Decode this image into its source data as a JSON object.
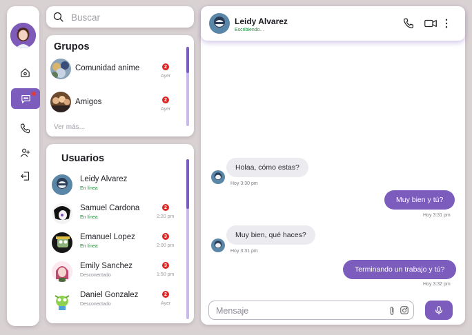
{
  "search": {
    "placeholder": "Buscar"
  },
  "groups": {
    "title": "Grupos",
    "items": [
      {
        "name": "Comunidad anime",
        "badge": "2",
        "time": "Ayer"
      },
      {
        "name": "Amigos",
        "badge": "2",
        "time": "Ayer"
      }
    ],
    "see_more": "Ver más..."
  },
  "users": {
    "title": "Usuarios",
    "items": [
      {
        "name": "Leidy Alvarez",
        "status": "En línea",
        "badge": "",
        "time": ""
      },
      {
        "name": "Samuel Cardona",
        "status": "En línea",
        "badge": "2",
        "time": "2:20 pm"
      },
      {
        "name": "Emanuel Lopez",
        "status": "En línea",
        "badge": "3",
        "time": "2:00 pm"
      },
      {
        "name": "Emily Sanchez",
        "status": "Desconectado",
        "badge": "3",
        "time": "1:50 pm"
      },
      {
        "name": "Daniel Gonzalez",
        "status": "Desconectado",
        "badge": "2",
        "time": "Ayer"
      }
    ]
  },
  "chat": {
    "contact_name": "Leidy Alvarez",
    "contact_status": "Escribiendo...",
    "messages": [
      {
        "direction": "in",
        "text": "Holaa, cómo estas?",
        "time": "Hoy 3:30 pm"
      },
      {
        "direction": "out",
        "text": "Muy bien y tú?",
        "time": "Hoy 3:31 pm"
      },
      {
        "direction": "in",
        "text": "Muy bien, qué haces?",
        "time": "Hoy 3:31 pm"
      },
      {
        "direction": "out",
        "text": "Terminando un trabajo y tú?",
        "time": "Hoy 3:32 pm"
      }
    ],
    "composer_placeholder": "Mensaje"
  },
  "colors": {
    "accent": "#7c5cbd",
    "online": "#1f8c3a",
    "badge": "#e02424",
    "background": "#d9d2d3"
  },
  "icons": [
    "home-icon",
    "chat-icon",
    "phone-icon",
    "add-user-icon",
    "logout-icon",
    "search-icon",
    "video-icon",
    "more-icon",
    "attach-icon",
    "image-icon",
    "mic-icon"
  ]
}
